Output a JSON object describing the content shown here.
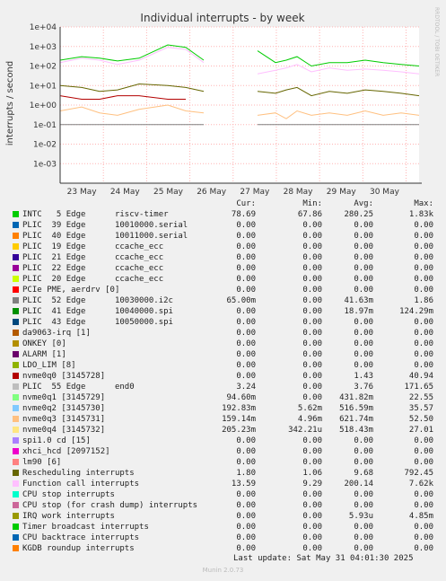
{
  "chart_data": {
    "type": "line",
    "title": "Individual interrupts - by week",
    "ylabel": "interrupts / second",
    "watermark": "RRDTOOL / TOBI OETIKER",
    "yscale": "log",
    "ylim": [
      0.0001,
      10000
    ],
    "y_ticks": [
      "1e+04",
      "1e+03",
      "1e+02",
      "1e+01",
      "1e+00",
      "1e-01",
      "1e-02",
      "1e-03"
    ],
    "x_ticks": [
      "23 May",
      "24 May",
      "25 May",
      "26 May",
      "27 May",
      "28 May",
      "29 May",
      "30 May"
    ],
    "grid": true,
    "legend_columns": [
      "Cur:",
      "Min:",
      "Avg:",
      "Max:"
    ],
    "series": [
      {
        "name": "INTC   5 Edge      riscv-timer",
        "color": "#00cc00",
        "cur": "78.69",
        "min": "67.86",
        "avg": "280.25",
        "max": "1.83k"
      },
      {
        "name": "PLIC  39 Edge      10010000.serial",
        "color": "#0066b3",
        "cur": "0.00",
        "min": "0.00",
        "avg": "0.00",
        "max": "0.00"
      },
      {
        "name": "PLIC  40 Edge      10011000.serial",
        "color": "#ff8000",
        "cur": "0.00",
        "min": "0.00",
        "avg": "0.00",
        "max": "0.00"
      },
      {
        "name": "PLIC  19 Edge      ccache_ecc",
        "color": "#ffcc00",
        "cur": "0.00",
        "min": "0.00",
        "avg": "0.00",
        "max": "0.00"
      },
      {
        "name": "PLIC  21 Edge      ccache_ecc",
        "color": "#330099",
        "cur": "0.00",
        "min": "0.00",
        "avg": "0.00",
        "max": "0.00"
      },
      {
        "name": "PLIC  22 Edge      ccache_ecc",
        "color": "#990099",
        "cur": "0.00",
        "min": "0.00",
        "avg": "0.00",
        "max": "0.00"
      },
      {
        "name": "PLIC  20 Edge      ccache_ecc",
        "color": "#ccff00",
        "cur": "0.00",
        "min": "0.00",
        "avg": "0.00",
        "max": "0.00"
      },
      {
        "name": "PCIe PME, aerdrv [0]",
        "color": "#ff0000",
        "cur": "0.00",
        "min": "0.00",
        "avg": "0.00",
        "max": "0.00"
      },
      {
        "name": "PLIC  52 Edge      10030000.i2c",
        "color": "#808080",
        "cur": "65.00m",
        "min": "0.00",
        "avg": "41.63m",
        "max": "1.86"
      },
      {
        "name": "PLIC  41 Edge      10040000.spi",
        "color": "#008f00",
        "cur": "0.00",
        "min": "0.00",
        "avg": "18.97m",
        "max": "124.29m"
      },
      {
        "name": "PLIC  43 Edge      10050000.spi",
        "color": "#00487d",
        "cur": "0.00",
        "min": "0.00",
        "avg": "0.00",
        "max": "0.00"
      },
      {
        "name": "da9063-irq [1]",
        "color": "#b35a00",
        "cur": "0.00",
        "min": "0.00",
        "avg": "0.00",
        "max": "0.00"
      },
      {
        "name": "ONKEY [0]",
        "color": "#b38f00",
        "cur": "0.00",
        "min": "0.00",
        "avg": "0.00",
        "max": "0.00"
      },
      {
        "name": "ALARM [1]",
        "color": "#6b006b",
        "cur": "0.00",
        "min": "0.00",
        "avg": "0.00",
        "max": "0.00"
      },
      {
        "name": "LDO_LIM [8]",
        "color": "#8fb300",
        "cur": "0.00",
        "min": "0.00",
        "avg": "0.00",
        "max": "0.00"
      },
      {
        "name": "nvme0q0 [3145728]",
        "color": "#b30000",
        "cur": "0.00",
        "min": "0.00",
        "avg": "1.43",
        "max": "40.94"
      },
      {
        "name": "PLIC  55 Edge      end0",
        "color": "#bebebe",
        "cur": "3.24",
        "min": "0.00",
        "avg": "3.76",
        "max": "171.65"
      },
      {
        "name": "nvme0q1 [3145729]",
        "color": "#80ff80",
        "cur": "94.60m",
        "min": "0.00",
        "avg": "431.82m",
        "max": "22.55"
      },
      {
        "name": "nvme0q2 [3145730]",
        "color": "#80c9ff",
        "cur": "192.83m",
        "min": "5.62m",
        "avg": "516.59m",
        "max": "35.57"
      },
      {
        "name": "nvme0q3 [3145731]",
        "color": "#ffc080",
        "cur": "159.14m",
        "min": "4.96m",
        "avg": "621.74m",
        "max": "52.50"
      },
      {
        "name": "nvme0q4 [3145732]",
        "color": "#ffe680",
        "cur": "205.23m",
        "min": "342.21u",
        "avg": "518.43m",
        "max": "27.01"
      },
      {
        "name": "spi1.0 cd [15]",
        "color": "#aa80ff",
        "cur": "0.00",
        "min": "0.00",
        "avg": "0.00",
        "max": "0.00"
      },
      {
        "name": "xhci_hcd [2097152]",
        "color": "#ee00cc",
        "cur": "0.00",
        "min": "0.00",
        "avg": "0.00",
        "max": "0.00"
      },
      {
        "name": "lm90 [6]",
        "color": "#ff8080",
        "cur": "0.00",
        "min": "0.00",
        "avg": "0.00",
        "max": "0.00"
      },
      {
        "name": "Rescheduling interrupts",
        "color": "#666600",
        "cur": "1.80",
        "min": "1.06",
        "avg": "9.68",
        "max": "792.45"
      },
      {
        "name": "Function call interrupts",
        "color": "#ffbfff",
        "cur": "13.59",
        "min": "9.29",
        "avg": "200.14",
        "max": "7.62k"
      },
      {
        "name": "CPU stop interrupts",
        "color": "#00ffcc",
        "cur": "0.00",
        "min": "0.00",
        "avg": "0.00",
        "max": "0.00"
      },
      {
        "name": "CPU stop (for crash dump) interrupts",
        "color": "#cc6699",
        "cur": "0.00",
        "min": "0.00",
        "avg": "0.00",
        "max": "0.00"
      },
      {
        "name": "IRQ work interrupts",
        "color": "#999900",
        "cur": "0.00",
        "min": "0.00",
        "avg": "5.93u",
        "max": "4.85m"
      },
      {
        "name": "Timer broadcast interrupts",
        "color": "#00cc00",
        "cur": "0.00",
        "min": "0.00",
        "avg": "0.00",
        "max": "0.00"
      },
      {
        "name": "CPU backtrace interrupts",
        "color": "#0066b3",
        "cur": "0.00",
        "min": "0.00",
        "avg": "0.00",
        "max": "0.00"
      },
      {
        "name": "KGDB roundup interrupts",
        "color": "#ff8000",
        "cur": "0.00",
        "min": "0.00",
        "avg": "0.00",
        "max": "0.00"
      }
    ],
    "lines": {
      "t": [
        0,
        0.06,
        0.11,
        0.16,
        0.22,
        0.3,
        0.35,
        0.4,
        0.43,
        0.46,
        0.5,
        0.55,
        0.6,
        0.63,
        0.66,
        0.7,
        0.75,
        0.8,
        0.85,
        0.9,
        0.95,
        1.0
      ],
      "timer": [
        200,
        300,
        250,
        180,
        250,
        1200,
        900,
        200,
        null,
        null,
        null,
        600,
        150,
        200,
        300,
        100,
        150,
        150,
        200,
        150,
        120,
        100
      ],
      "func": [
        150,
        250,
        200,
        120,
        200,
        900,
        700,
        150,
        null,
        null,
        null,
        40,
        60,
        80,
        120,
        50,
        80,
        60,
        70,
        60,
        50,
        40
      ],
      "resched": [
        10,
        8,
        5,
        6,
        12,
        10,
        8,
        5,
        null,
        null,
        null,
        5,
        4,
        6,
        8,
        3,
        5,
        4,
        6,
        5,
        4,
        3
      ],
      "nvme": [
        0.5,
        0.8,
        0.4,
        0.3,
        0.6,
        1.0,
        0.5,
        0.4,
        null,
        null,
        null,
        0.3,
        0.4,
        0.2,
        0.5,
        0.3,
        0.4,
        0.3,
        0.5,
        0.3,
        0.4,
        0.3
      ],
      "end0": [
        0.1,
        0.1,
        0.1,
        0.1,
        0.1,
        0.1,
        0.1,
        0.1,
        null,
        null,
        null,
        0.1,
        0.1,
        0.1,
        0.1,
        0.1,
        0.1,
        0.1,
        0.1,
        0.1,
        0.1,
        0.1
      ],
      "nvme0q0": [
        3,
        2,
        2,
        3,
        3,
        2,
        2,
        null,
        null,
        null,
        null,
        null,
        null,
        null,
        null,
        null,
        null,
        null,
        null,
        null,
        null,
        null
      ]
    }
  },
  "footer": {
    "last_update": "Last update: Sat May 31 04:01:30 2025",
    "munin": "Munin 2.0.73"
  }
}
